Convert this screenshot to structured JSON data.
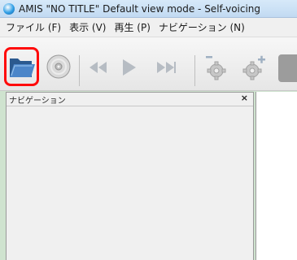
{
  "window": {
    "title": "AMIS \"NO TITLE\" Default view mode - Self-voicing"
  },
  "menu": {
    "items": [
      {
        "label": "ファイル (F)"
      },
      {
        "label": "表示 (V)"
      },
      {
        "label": "再生 (P)"
      },
      {
        "label": "ナビゲーション (N)"
      }
    ]
  },
  "toolbar": {
    "buttons": [
      {
        "name": "open-file",
        "icon": "folder-icon",
        "highlighted": true
      },
      {
        "name": "open-cd",
        "icon": "cd-icon"
      },
      {
        "name": "rewind",
        "icon": "rewind-icon"
      },
      {
        "name": "play",
        "icon": "play-icon"
      },
      {
        "name": "fast-forward",
        "icon": "fast-forward-icon"
      },
      {
        "name": "decrease",
        "icon": "gear-minus-icon"
      },
      {
        "name": "increase",
        "icon": "gear-plus-icon"
      }
    ],
    "highlight_color": "#ff0a0a"
  },
  "navigation_panel": {
    "title": "ナビゲーション",
    "close_label": "×"
  }
}
